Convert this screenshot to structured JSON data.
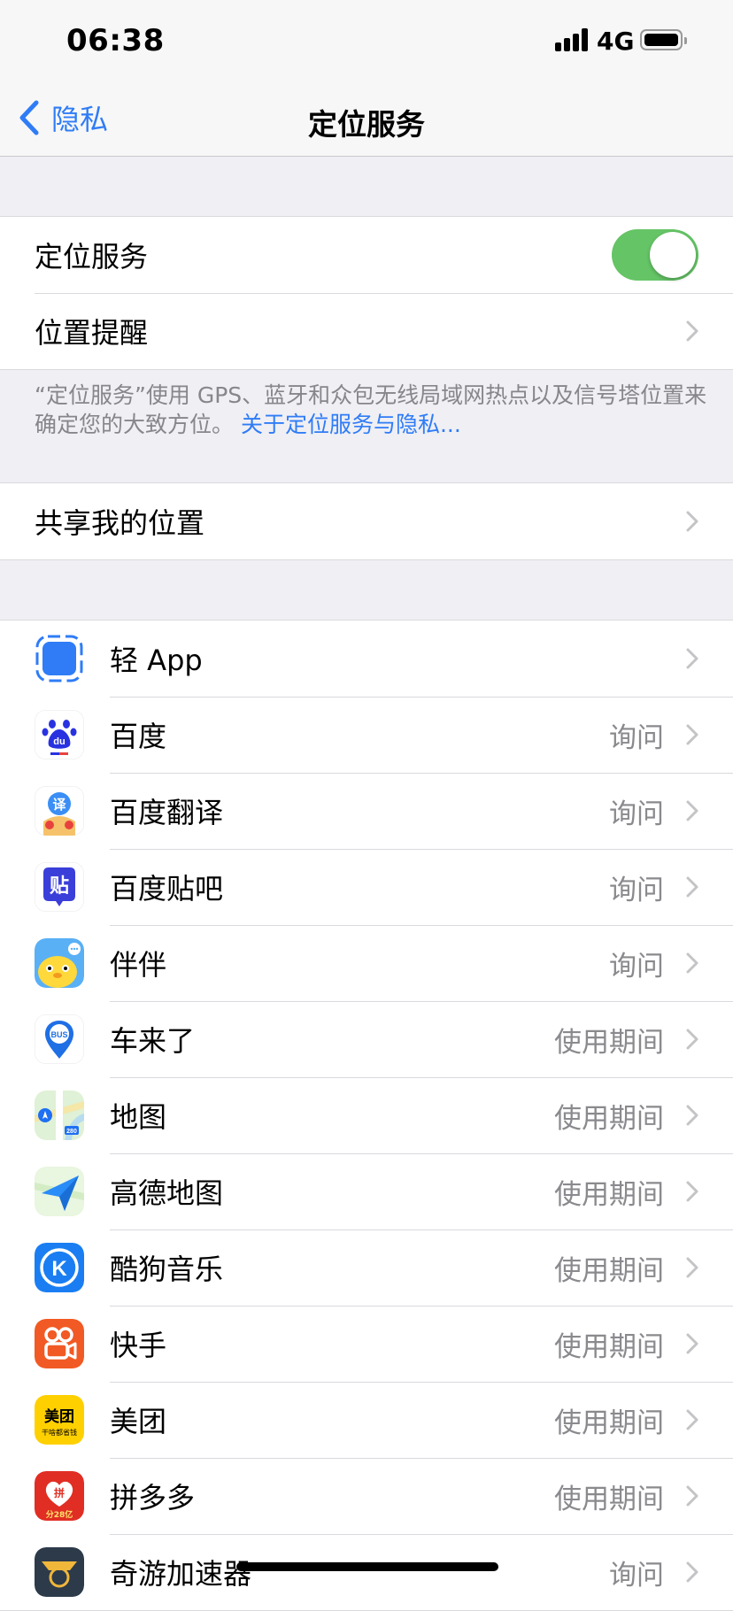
{
  "status_bar": {
    "time": "06:38",
    "network": "4G"
  },
  "nav": {
    "back_label": "隐私",
    "title": "定位服务"
  },
  "settings": {
    "location_services": {
      "label": "定位服务",
      "enabled": true
    },
    "location_alerts": {
      "label": "位置提醒"
    }
  },
  "footer": {
    "text": "“定位服务”使用 GPS、蓝牙和众包无线局域网热点以及信号塔位置来确定您的大致方位。",
    "link": "关于定位服务与隐私..."
  },
  "share": {
    "label": "共享我的位置"
  },
  "apps": [
    {
      "name": "轻 App",
      "value": "",
      "icon": "light-app-icon"
    },
    {
      "name": "百度",
      "value": "询问",
      "icon": "baidu-icon"
    },
    {
      "name": "百度翻译",
      "value": "询问",
      "icon": "baidu-translate-icon"
    },
    {
      "name": "百度贴吧",
      "value": "询问",
      "icon": "baidu-tieba-icon"
    },
    {
      "name": "伴伴",
      "value": "询问",
      "icon": "banban-icon"
    },
    {
      "name": "车来了",
      "value": "使用期间",
      "icon": "chelaile-icon"
    },
    {
      "name": "地图",
      "value": "使用期间",
      "icon": "maps-icon"
    },
    {
      "name": "高德地图",
      "value": "使用期间",
      "icon": "amap-icon"
    },
    {
      "name": "酷狗音乐",
      "value": "使用期间",
      "icon": "kugou-icon"
    },
    {
      "name": "快手",
      "value": "使用期间",
      "icon": "kuaishou-icon"
    },
    {
      "name": "美团",
      "value": "使用期间",
      "icon": "meituan-icon"
    },
    {
      "name": "拼多多",
      "value": "使用期间",
      "icon": "pinduoduo-icon"
    },
    {
      "name": "奇游加速器",
      "value": "询问",
      "icon": "qiyou-accelerator-icon"
    }
  ],
  "icon_text": {
    "baidu": "du",
    "translate": "译",
    "tieba": "贴",
    "chelaile": "BUS",
    "maps_shield": "280",
    "kugou": "K",
    "meituan": "美团",
    "meituan_sub": "干啥都省钱",
    "pinduoduo": "拼",
    "pinduoduo_sub": "分28亿"
  },
  "colors": {
    "accent": "#2f7cf6",
    "toggle_on": "#65c466",
    "secondary_text": "#8a8a8e"
  }
}
